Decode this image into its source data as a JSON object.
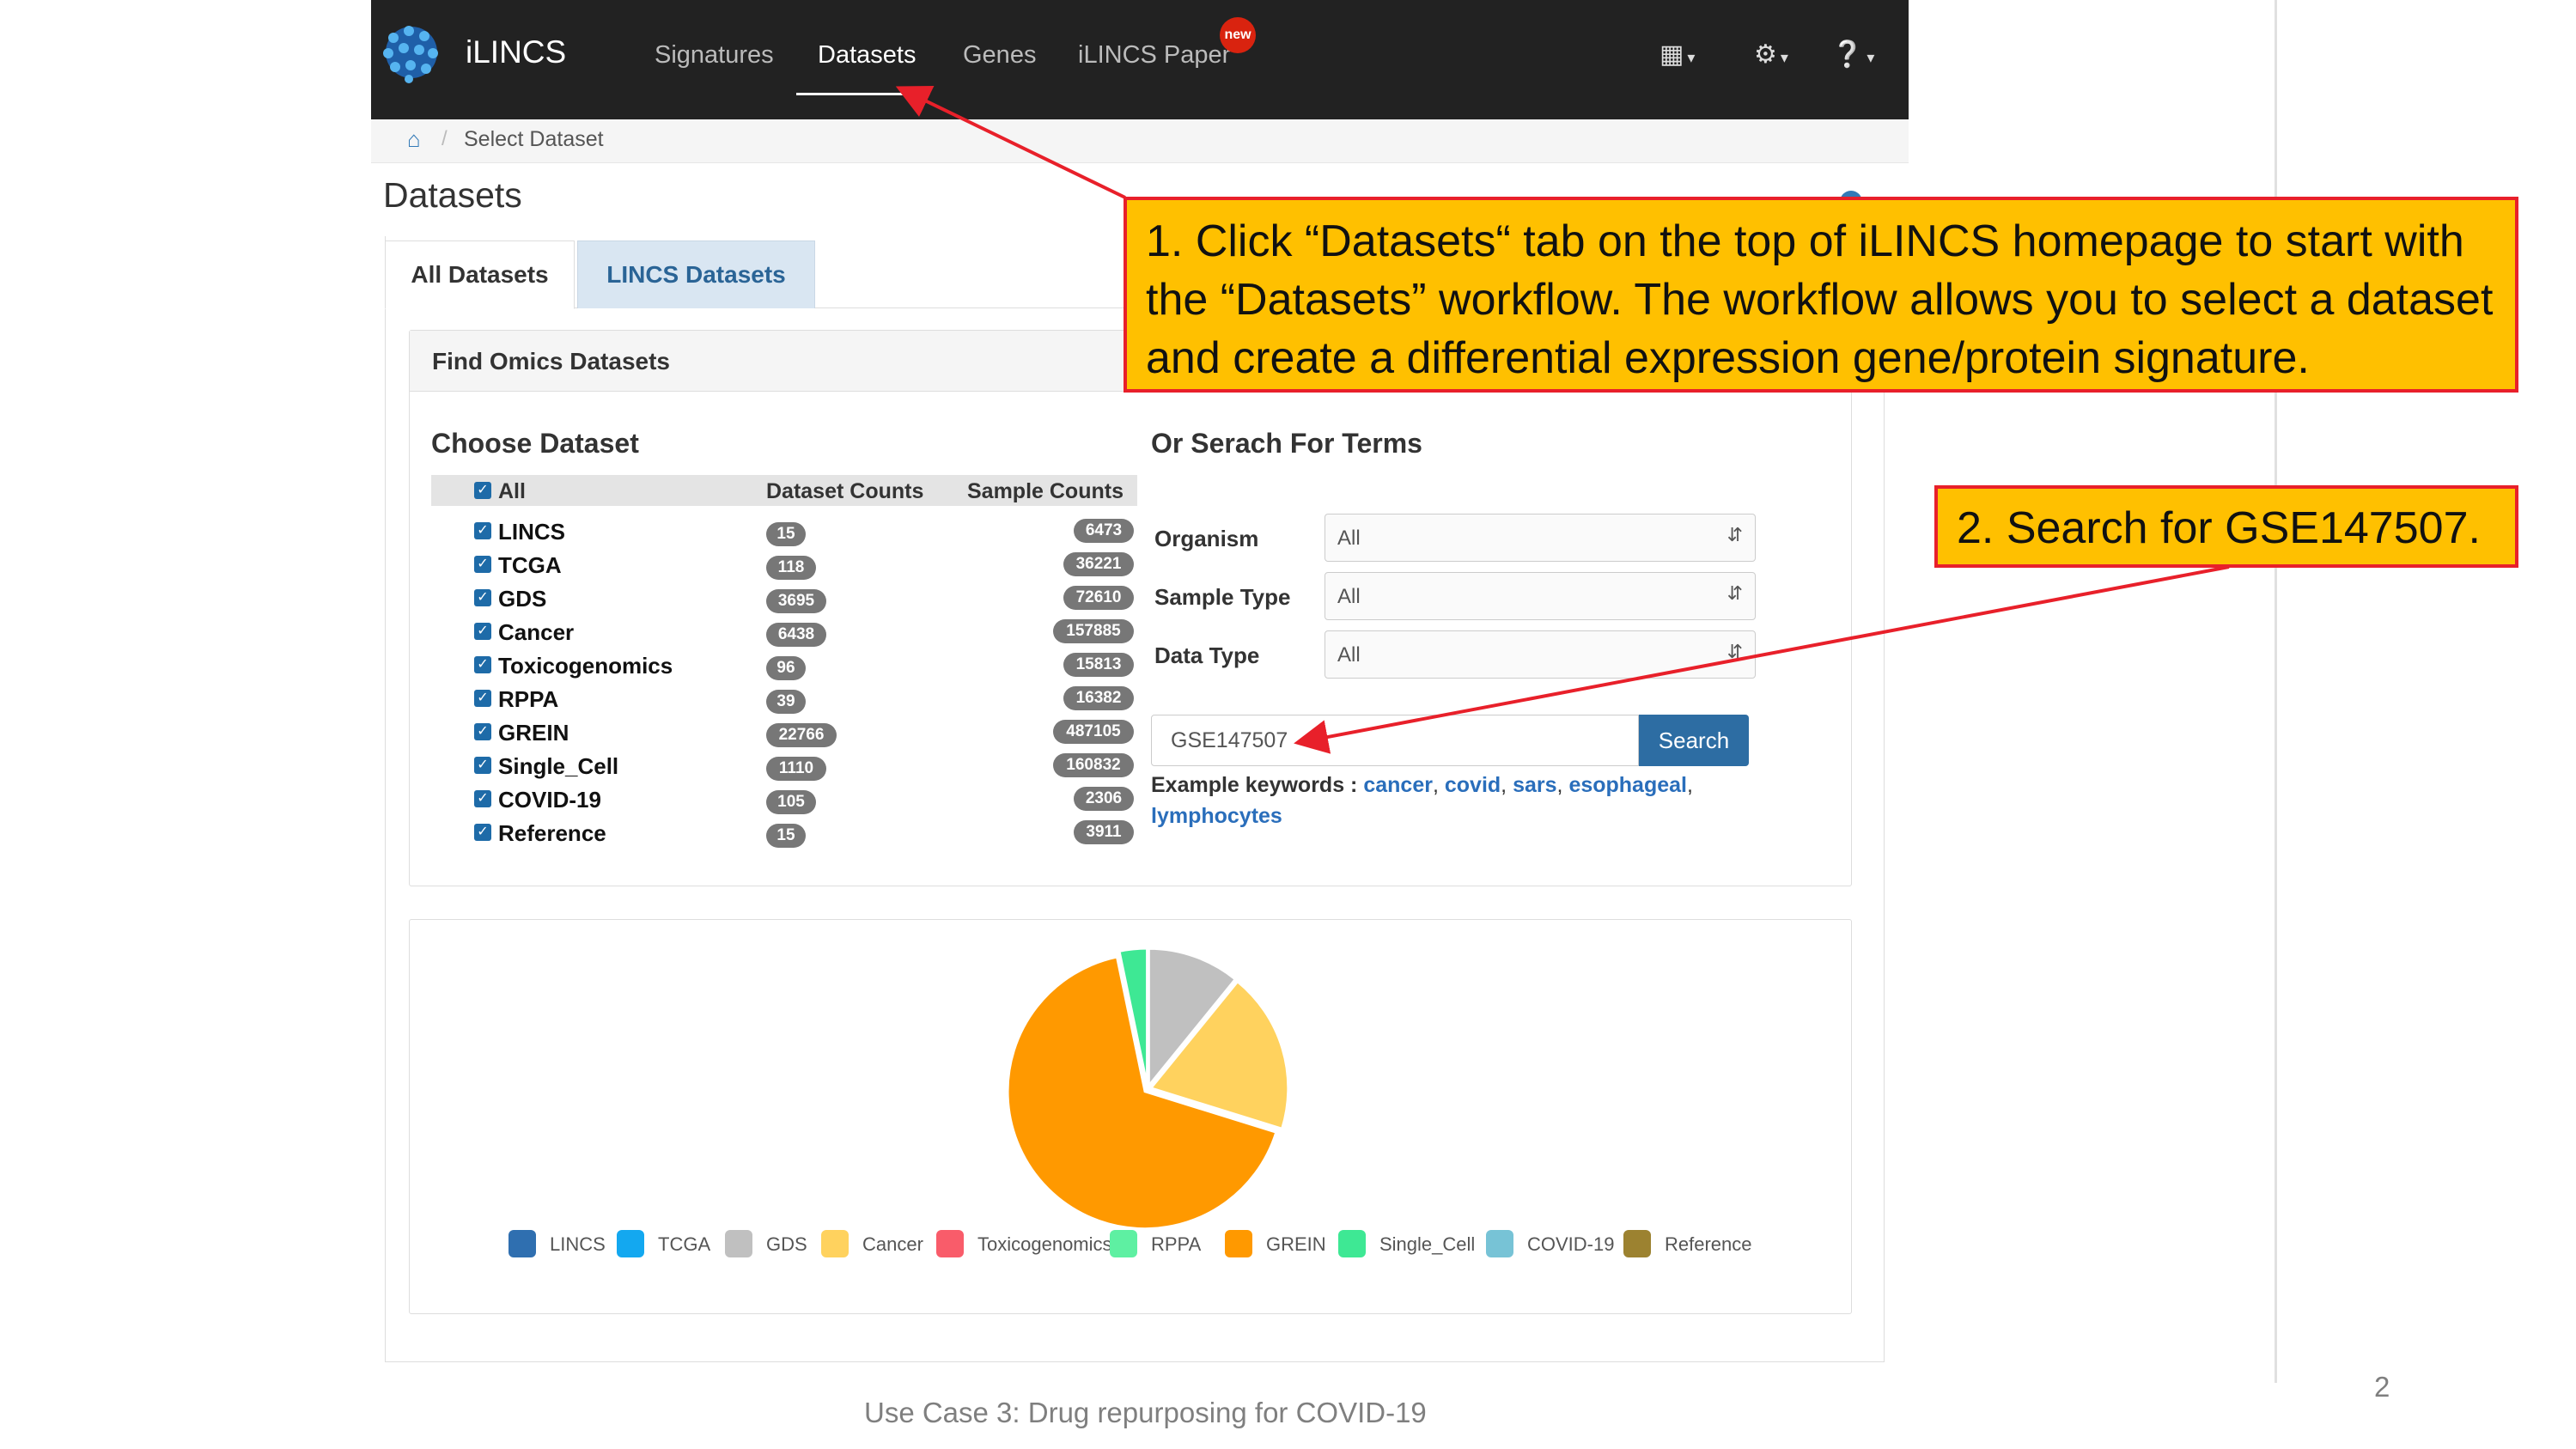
{
  "navbar": {
    "brand": "iLINCS",
    "links": [
      "Signatures",
      "Datasets",
      "Genes",
      "iLINCS Paper"
    ],
    "new_badge": "new",
    "icons": [
      "grid-icon",
      "gear-icon",
      "help-icon"
    ]
  },
  "breadcrumb": {
    "current": "Select Dataset"
  },
  "page_title": "Datasets",
  "tabs": [
    {
      "label": "All Datasets",
      "active": true
    },
    {
      "label": "LINCS Datasets",
      "active": false
    }
  ],
  "find_panel": {
    "title": "Find Omics Datasets",
    "choose_title": "Choose Dataset",
    "headers": {
      "all": "All",
      "dataset_counts": "Dataset Counts",
      "sample_counts": "Sample Counts"
    },
    "datasets": [
      {
        "name": "LINCS",
        "dataset_count": "15",
        "sample_count": "6473"
      },
      {
        "name": "TCGA",
        "dataset_count": "118",
        "sample_count": "36221"
      },
      {
        "name": "GDS",
        "dataset_count": "3695",
        "sample_count": "72610"
      },
      {
        "name": "Cancer",
        "dataset_count": "6438",
        "sample_count": "157885"
      },
      {
        "name": "Toxicogenomics",
        "dataset_count": "96",
        "sample_count": "15813"
      },
      {
        "name": "RPPA",
        "dataset_count": "39",
        "sample_count": "16382"
      },
      {
        "name": "GREIN",
        "dataset_count": "22766",
        "sample_count": "487105"
      },
      {
        "name": "Single_Cell",
        "dataset_count": "1110",
        "sample_count": "160832"
      },
      {
        "name": "COVID-19",
        "dataset_count": "105",
        "sample_count": "2306"
      },
      {
        "name": "Reference",
        "dataset_count": "15",
        "sample_count": "3911"
      }
    ],
    "search_title": "Or Serach For Terms",
    "selects": [
      {
        "label": "Organism",
        "value": "All"
      },
      {
        "label": "Sample Type",
        "value": "All"
      },
      {
        "label": "Data Type",
        "value": "All"
      }
    ],
    "search_value": "GSE147507",
    "search_button": "Search",
    "examples_label": "Example keywords :",
    "keywords": [
      "cancer",
      "covid",
      "sars",
      "esophageal",
      "lymphocytes"
    ]
  },
  "chart_data": {
    "type": "pie",
    "series": [
      {
        "name": "GDS",
        "value": 3695,
        "color": "#c0c0c0"
      },
      {
        "name": "Cancer",
        "value": 6438,
        "color": "#ffd25e"
      },
      {
        "name": "GREIN",
        "value": 22766,
        "color": "#ff9900"
      },
      {
        "name": "Single_Cell",
        "value": 1110,
        "color": "#3ee894"
      }
    ],
    "legend": [
      {
        "name": "LINCS",
        "color": "#2f6fb0"
      },
      {
        "name": "TCGA",
        "color": "#13a8f0"
      },
      {
        "name": "GDS",
        "color": "#c0c0c0"
      },
      {
        "name": "Cancer",
        "color": "#ffd25e"
      },
      {
        "name": "Toxicogenomics",
        "color": "#f95c6a"
      },
      {
        "name": "RPPA",
        "color": "#5ef0a2"
      },
      {
        "name": "GREIN",
        "color": "#ff9900"
      },
      {
        "name": "Single_Cell",
        "color": "#3ee894"
      },
      {
        "name": "COVID-19",
        "color": "#77c3d6"
      },
      {
        "name": "Reference",
        "color": "#9c8230"
      }
    ],
    "legend_position": "bottom"
  },
  "annotations": {
    "note1": "1. Click “Datasets“ tab on the top of iLINCS homepage to start with the “Datasets” workflow. The workflow allows you to select a dataset and create a differential expression gene/protein signature.",
    "note2": "2. Search for GSE147507."
  },
  "footer": "Use Case 3: Drug repurposing for COVID-19",
  "page_number": "2",
  "colors": {
    "navbar": "#222222",
    "link": "#2a6ebb",
    "button": "#2d6da3",
    "callout_fill": "#ffc000",
    "callout_border": "#e8202a"
  }
}
